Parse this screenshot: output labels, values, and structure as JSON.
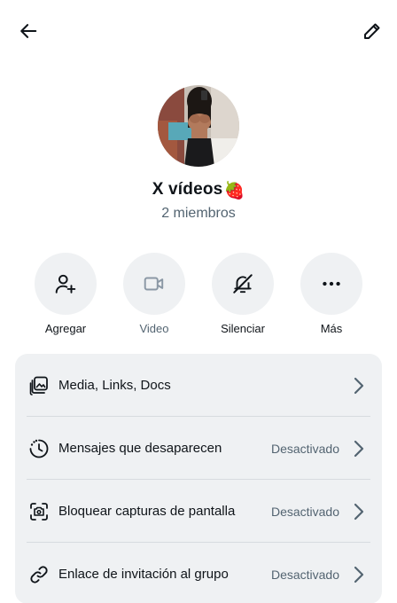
{
  "header": {
    "back_icon": "arrow-left-icon",
    "edit_icon": "pencil-icon"
  },
  "group": {
    "name": "X vídeos",
    "name_emoji": "🍓",
    "members": "2 miembros"
  },
  "actions": [
    {
      "label": "Agregar",
      "icon": "add-user-icon"
    },
    {
      "label": "Video",
      "icon": "video-camera-icon"
    },
    {
      "label": "Silenciar",
      "icon": "bell-off-icon"
    },
    {
      "label": "Más",
      "icon": "more-dots-icon"
    }
  ],
  "settings": [
    {
      "label": "Media, Links, Docs",
      "value": "",
      "icon": "media-stack-icon"
    },
    {
      "label": "Mensajes que desaparecen",
      "value": "Desactivado",
      "icon": "timer-icon"
    },
    {
      "label": "Bloquear capturas de pantalla",
      "value": "Desactivado",
      "icon": "screenshot-camera-icon"
    },
    {
      "label": "Enlace de invitación al grupo",
      "value": "Desactivado",
      "icon": "link-icon"
    }
  ],
  "colors": {
    "text": "#0f1419",
    "secondary": "#536471",
    "surface": "#eff1f3"
  }
}
